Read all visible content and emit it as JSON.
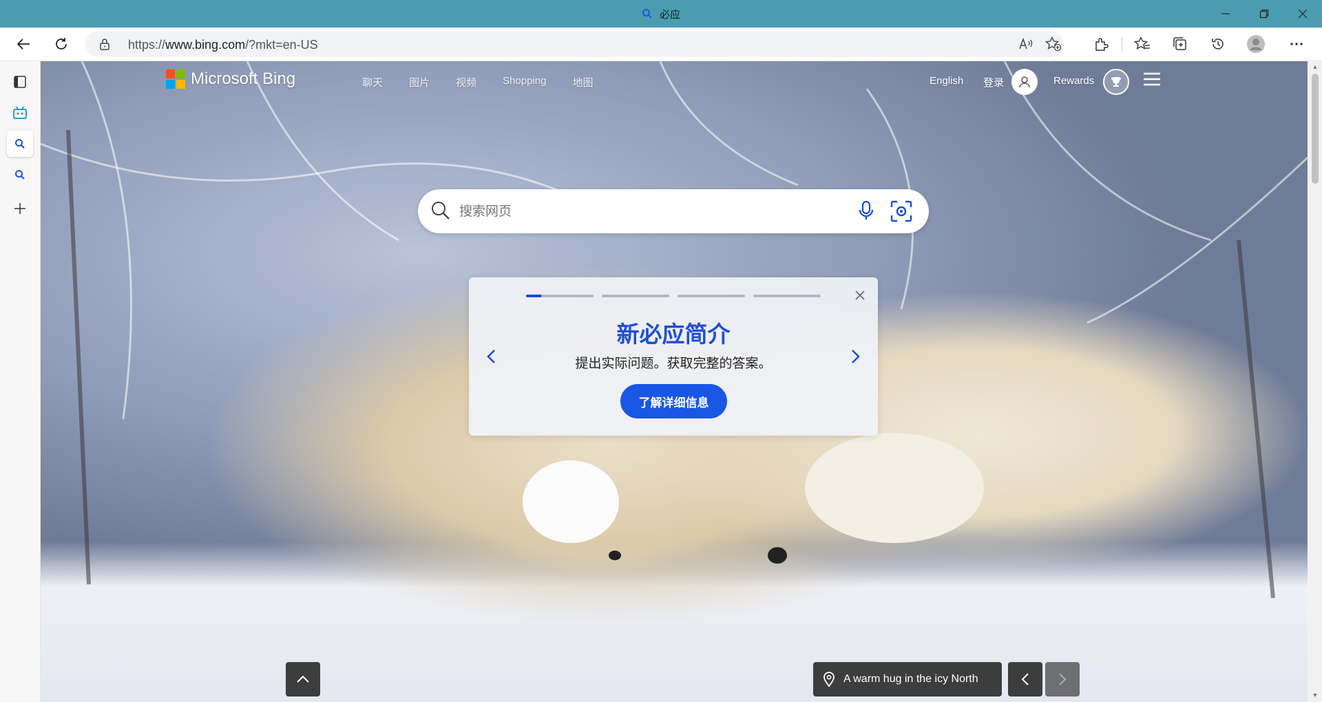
{
  "window": {
    "title": "必应",
    "controls": [
      "minimize-icon",
      "restore-icon",
      "close-icon"
    ]
  },
  "toolbar": {
    "url_prefix": "https://",
    "url_host": "www.bing.com",
    "url_path": "/?mkt=en-US"
  },
  "sidebar": {
    "items": [
      "tab-actions-icon",
      "bot-icon",
      "search-icon",
      "search-icon",
      "add-icon"
    ]
  },
  "header": {
    "brand": "Microsoft Bing",
    "nav": [
      "聊天",
      "图片",
      "视频",
      "Shopping",
      "地图"
    ],
    "language": "English",
    "signin": "登录",
    "rewards": "Rewards"
  },
  "search": {
    "placeholder": "搜索网页"
  },
  "intro_card": {
    "title": "新必应简介",
    "subtitle": "提出实际问题。获取完整的答案。",
    "button": "了解详细信息",
    "progress": [
      0.22,
      0,
      0,
      0
    ]
  },
  "footer": {
    "caption": "A warm hug in the icy North"
  },
  "colors": {
    "titlebar": "#4a9db0",
    "accent": "#1a56e6",
    "card_title": "#1d4ed8"
  }
}
